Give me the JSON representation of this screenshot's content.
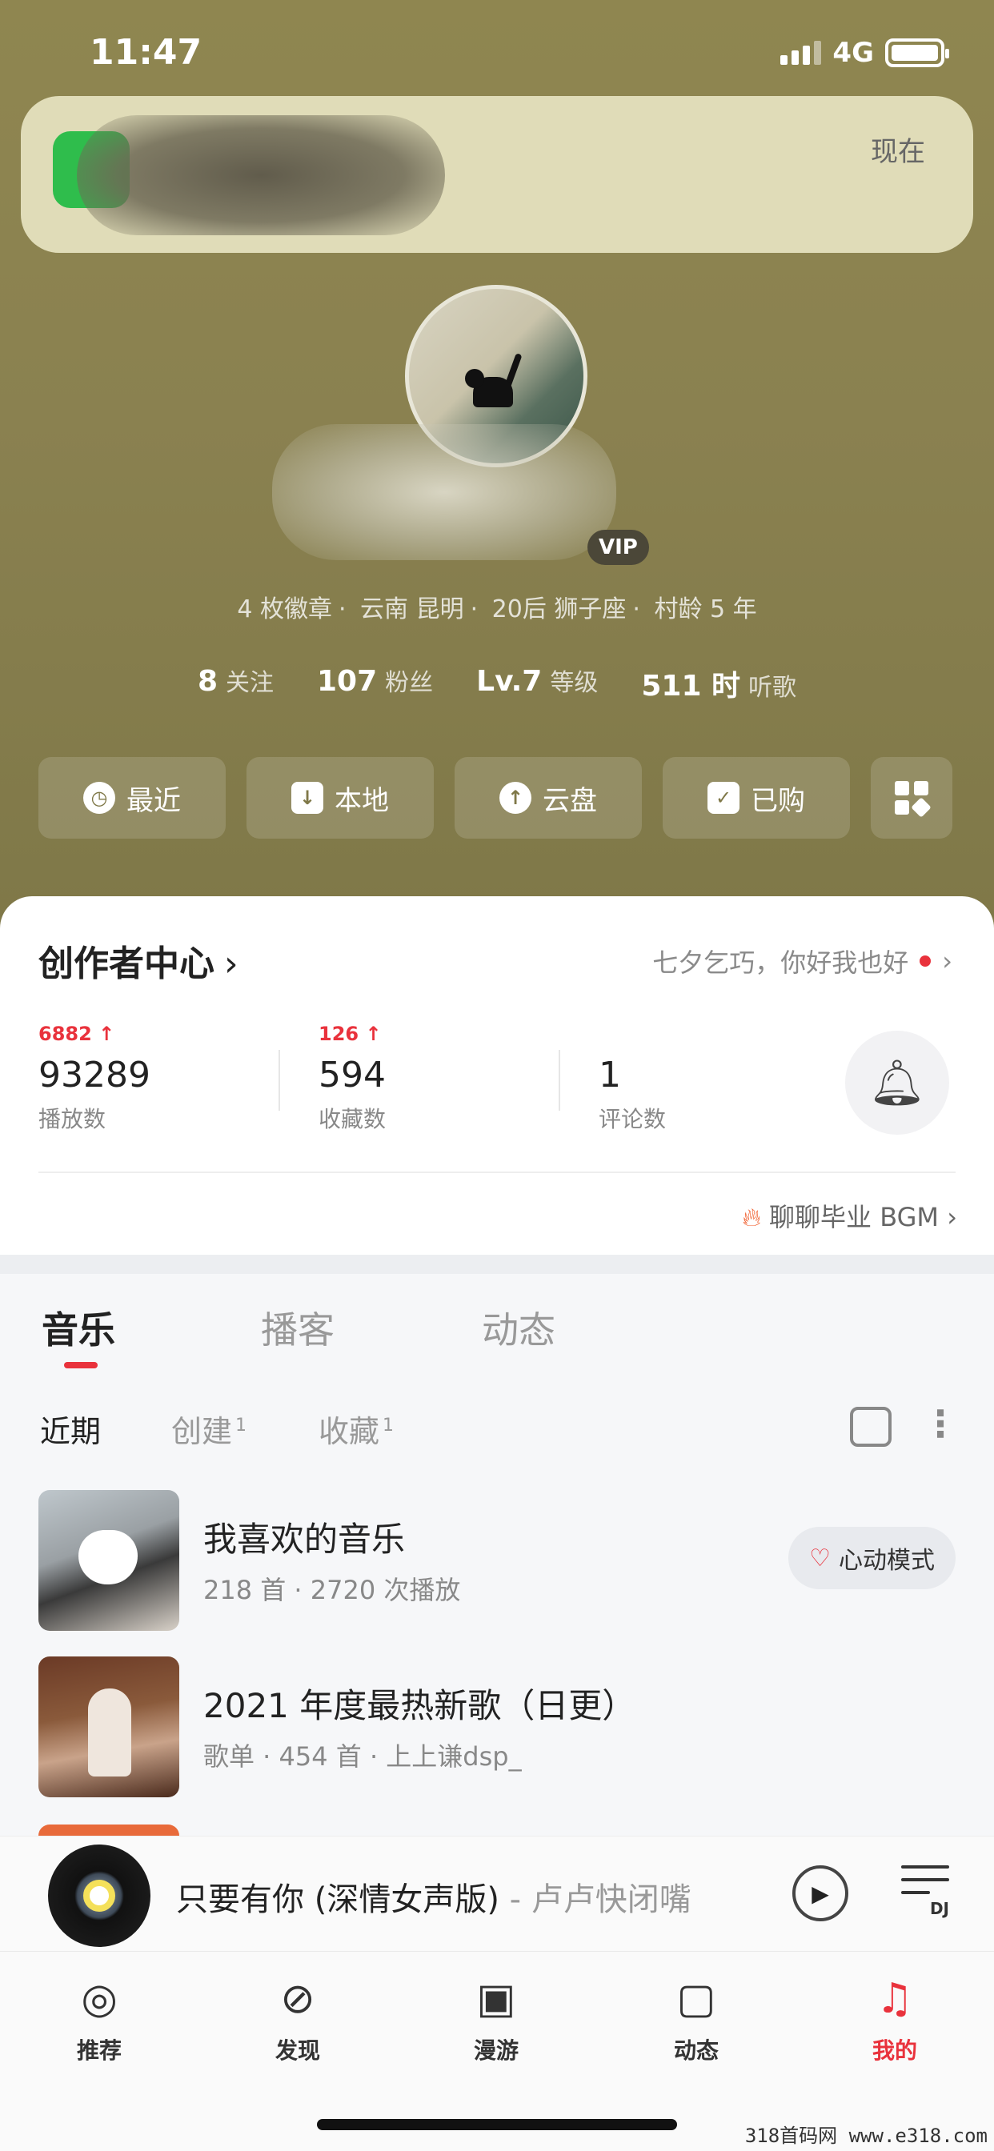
{
  "status_bar": {
    "time": "11:47",
    "network": "4G"
  },
  "notification": {
    "time": "现在"
  },
  "profile": {
    "vip_badge": "VIP",
    "info_line": [
      "4 枚徽章",
      "云南 昆明",
      "20后 狮子座",
      "村龄 5 年"
    ],
    "stats": [
      {
        "value": "8",
        "label": "关注"
      },
      {
        "value": "107",
        "label": "粉丝"
      },
      {
        "value": "Lv.7",
        "label": "等级"
      },
      {
        "value": "511 时",
        "label": "听歌"
      }
    ]
  },
  "quick_actions": [
    {
      "label": "最近",
      "icon": "clock-icon"
    },
    {
      "label": "本地",
      "icon": "download-icon"
    },
    {
      "label": "云盘",
      "icon": "cloud-upload-icon"
    },
    {
      "label": "已购",
      "icon": "shopping-bag-icon"
    }
  ],
  "creator": {
    "title": "创作者中心",
    "promo": "七夕乞巧，你好我也好",
    "stats": [
      {
        "delta": "6882 ↑",
        "value": "93289",
        "label": "播放数"
      },
      {
        "delta": "126 ↑",
        "value": "594",
        "label": "收藏数"
      },
      {
        "delta": "",
        "value": "1",
        "label": "评论数"
      }
    ],
    "bgm_link": "聊聊毕业 BGM"
  },
  "tabs": [
    "音乐",
    "播客",
    "动态"
  ],
  "subtabs": [
    {
      "label": "近期",
      "count": ""
    },
    {
      "label": "创建",
      "count": "1"
    },
    {
      "label": "收藏",
      "count": "1"
    }
  ],
  "playlists": [
    {
      "title": "我喜欢的音乐",
      "subtitle": "218 首 · 2720 次播放",
      "action": "心动模式"
    },
    {
      "title": "2021 年度最热新歌（日更）",
      "subtitle": "歌单 · 454 首 · 上上谦dsp_"
    }
  ],
  "player": {
    "song": "只要有你 (深情女声版)",
    "artist": " - 卢卢快闭嘴",
    "dj_label": "DJ"
  },
  "bottom_nav": [
    {
      "label": "推荐",
      "icon": "netease-logo-icon"
    },
    {
      "label": "发现",
      "icon": "compass-icon"
    },
    {
      "label": "漫游",
      "icon": "radio-icon"
    },
    {
      "label": "动态",
      "icon": "chat-bubble-icon"
    },
    {
      "label": "我的",
      "icon": "music-note-icon"
    }
  ],
  "watermark": "318首码网  www.e318.com",
  "colors": {
    "accent": "#e9323c",
    "hero": "#8a8150"
  }
}
